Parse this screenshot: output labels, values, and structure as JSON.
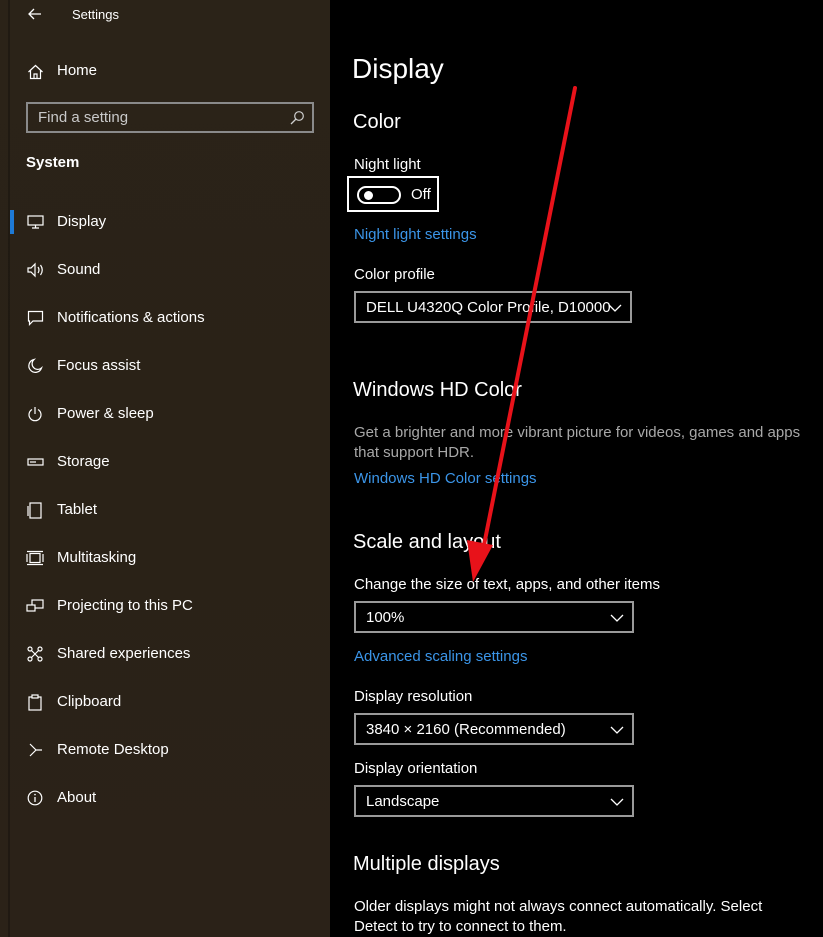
{
  "window": {
    "title": "Settings"
  },
  "sidebar": {
    "home_label": "Home",
    "search_placeholder": "Find a setting",
    "section": "System",
    "items": [
      {
        "label": "Display",
        "icon": "monitor-icon",
        "active": true
      },
      {
        "label": "Sound",
        "icon": "speaker-icon"
      },
      {
        "label": "Notifications & actions",
        "icon": "notification-icon"
      },
      {
        "label": "Focus assist",
        "icon": "moon-icon"
      },
      {
        "label": "Power & sleep",
        "icon": "power-icon"
      },
      {
        "label": "Storage",
        "icon": "storage-icon"
      },
      {
        "label": "Tablet",
        "icon": "tablet-icon"
      },
      {
        "label": "Multitasking",
        "icon": "multitasking-icon"
      },
      {
        "label": "Projecting to this PC",
        "icon": "projecting-icon"
      },
      {
        "label": "Shared experiences",
        "icon": "shared-icon"
      },
      {
        "label": "Clipboard",
        "icon": "clipboard-icon"
      },
      {
        "label": "Remote Desktop",
        "icon": "remote-desktop-icon"
      },
      {
        "label": "About",
        "icon": "info-icon"
      }
    ]
  },
  "main": {
    "page_title": "Display",
    "color": {
      "heading": "Color",
      "night_light_label": "Night light",
      "night_light_state": "Off",
      "night_light_link": "Night light settings",
      "color_profile_label": "Color profile",
      "color_profile_value": "DELL U4320Q Color Profile, D10000"
    },
    "hd_color": {
      "heading": "Windows HD Color",
      "description_line1": "Get a brighter and more vibrant picture for videos, games and apps",
      "description_line2": "that support HDR.",
      "link": "Windows HD Color settings"
    },
    "scale": {
      "heading": "Scale and layout",
      "size_label": "Change the size of text, apps, and other items",
      "size_value": "100%",
      "advanced_link": "Advanced scaling settings",
      "resolution_label": "Display resolution",
      "resolution_value": "3840 × 2160 (Recommended)",
      "orientation_label": "Display orientation",
      "orientation_value": "Landscape"
    },
    "multiple": {
      "heading": "Multiple displays",
      "text_line1": "Older displays might not always connect automatically. Select",
      "text_line2": "Detect to try to connect to them."
    }
  },
  "annotation": {
    "color": "#e8121a"
  }
}
